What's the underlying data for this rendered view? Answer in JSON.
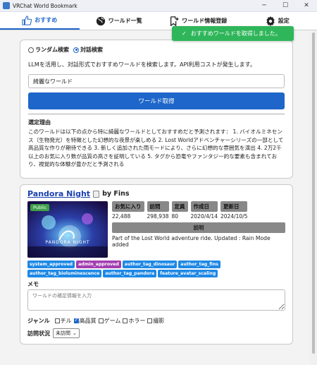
{
  "window": {
    "title": "VRChat World Bookmark",
    "minimize": "─",
    "maximize": "☐",
    "close": "✕"
  },
  "tabs": [
    {
      "label": "おすすめ",
      "icon": "thumbs-up-icon"
    },
    {
      "label": "ワールド一覧",
      "icon": "globe-icon"
    },
    {
      "label": "ワールド情報登録",
      "icon": "bookmark-add-icon"
    },
    {
      "label": "設定",
      "icon": "gear-icon"
    }
  ],
  "toast": {
    "message": "おすすめワールドを取得しました。",
    "color": "#2fb65a"
  },
  "search": {
    "mode_random": "ランダム検索",
    "mode_chat": "対話検索",
    "description": "LLMを活用し、対話形式でおすすめワールドを検索します。API利用コストが発生します。",
    "query": "綺麗なワールド",
    "button": "ワールド取得",
    "reason_title": "選定理由",
    "reason_body": "このワールドは以下の点から特に綺麗なワールドとしておすすめだと予測されます： 1. バイオルミネセンス（生物発光）を特徴とした幻想的な夜景が楽しめる 2. Lost Worldアドベンチャーシリーズの一部として高品質な作りが期待できる 3. 新しく追加された雨モードにより、さらに幻想的な雰囲気を演出 4. 2万2千以上のお気に入り数が品質の高さを証明している 5. タグから恐竜やファンタジー的な要素も含まれており、視覚的な体験が豊かだと予測される"
  },
  "world": {
    "name": "Pandora Night",
    "by": "by Fins",
    "public_badge": "Public",
    "stats": [
      {
        "label": "お気に入り",
        "value": "22,488"
      },
      {
        "label": "訪問",
        "value": "298,938"
      },
      {
        "label": "定員",
        "value": "80"
      },
      {
        "label": "作成日",
        "value": "2020/4/14"
      },
      {
        "label": "更新日",
        "value": "2024/10/5"
      }
    ],
    "explanation_title": "説明",
    "explanation": "Part of the Lost World adventure ride. Updated : Rain Mode added",
    "tags": [
      {
        "label": "system_approved",
        "color": "#1e88e5"
      },
      {
        "label": "admin_approved",
        "color": "#a23fb0"
      },
      {
        "label": "author_tag_dinosaur",
        "color": "#1e88e5"
      },
      {
        "label": "author_tag_fins",
        "color": "#1e88e5"
      },
      {
        "label": "author_tag_bioluminescence",
        "color": "#1e88e5"
      },
      {
        "label": "author_tag_pandora",
        "color": "#1e88e5"
      },
      {
        "label": "feature_avatar_scaling",
        "color": "#1e88e5"
      }
    ],
    "memo_label": "メモ",
    "memo_placeholder": "ワールドの補足情報を入力",
    "genre_label": "ジャンル",
    "genres": [
      {
        "label": "チル",
        "checked": false
      },
      {
        "label": "高品質",
        "checked": true
      },
      {
        "label": "ゲーム",
        "checked": false
      },
      {
        "label": "ホラー",
        "checked": false
      },
      {
        "label": "撮影",
        "checked": false
      }
    ],
    "visit_label": "訪問状況",
    "visit_value": "未訪問"
  }
}
